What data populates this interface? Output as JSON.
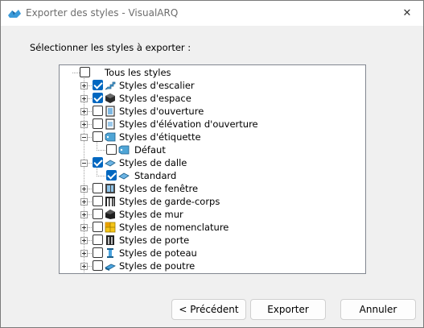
{
  "window": {
    "title": "Exporter des styles - VisualARQ",
    "close_glyph": "✕"
  },
  "instruction": "Sélectionner les styles à exporter :",
  "tree": {
    "root": {
      "label": "Tous les styles",
      "checked": false
    },
    "items": [
      {
        "label": "Styles d'escalier",
        "checked": true,
        "expanded": false,
        "icon": "stair-icon"
      },
      {
        "label": "Styles d'espace",
        "checked": true,
        "expanded": false,
        "icon": "space-icon"
      },
      {
        "label": "Styles d'ouverture",
        "checked": false,
        "expanded": false,
        "icon": "opening-icon"
      },
      {
        "label": "Styles d'élévation d'ouverture",
        "checked": false,
        "expanded": false,
        "icon": "opening-elevation-icon"
      },
      {
        "label": "Styles d'étiquette",
        "checked": false,
        "expanded": true,
        "icon": "label-tag-icon",
        "children": [
          {
            "label": "Défaut",
            "checked": false,
            "icon": "label-tag-icon"
          }
        ]
      },
      {
        "label": "Styles de dalle",
        "checked": true,
        "expanded": true,
        "icon": "slab-icon",
        "children": [
          {
            "label": "Standard",
            "checked": true,
            "icon": "slab-icon"
          }
        ]
      },
      {
        "label": "Styles de fenêtre",
        "checked": false,
        "expanded": false,
        "icon": "window-icon"
      },
      {
        "label": "Styles de garde-corps",
        "checked": false,
        "expanded": false,
        "icon": "railing-icon"
      },
      {
        "label": "Styles de mur",
        "checked": false,
        "expanded": false,
        "icon": "wall-icon"
      },
      {
        "label": "Styles de nomenclature",
        "checked": false,
        "expanded": false,
        "icon": "table-icon"
      },
      {
        "label": "Styles de porte",
        "checked": false,
        "expanded": false,
        "icon": "door-icon"
      },
      {
        "label": "Styles de poteau",
        "checked": false,
        "expanded": false,
        "icon": "column-icon"
      },
      {
        "label": "Styles de poutre",
        "checked": false,
        "expanded": false,
        "icon": "beam-icon"
      }
    ]
  },
  "buttons": {
    "previous": "< Précédent",
    "export": "Exporter",
    "cancel": "Annuler"
  },
  "colors": {
    "accent": "#0067c0",
    "titlebar": "#ffffff",
    "dialog_bg": "#f0f0f0"
  }
}
